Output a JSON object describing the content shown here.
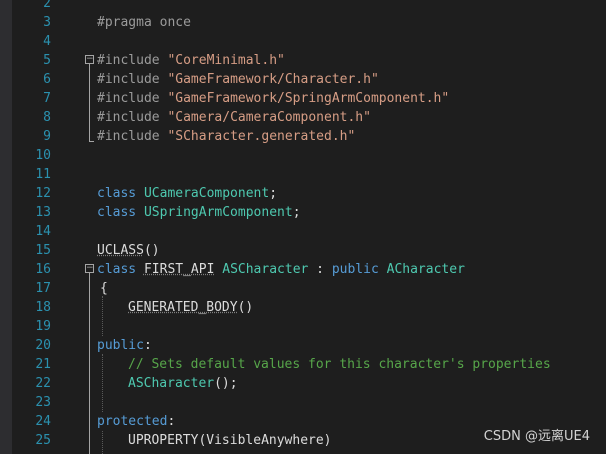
{
  "editor": {
    "lines": [
      {
        "n": "2",
        "text": ""
      },
      {
        "n": "3",
        "text": "#pragma once"
      },
      {
        "n": "4",
        "text": ""
      },
      {
        "n": "5",
        "text": "#include \"CoreMinimal.h\""
      },
      {
        "n": "6",
        "text": "#include \"GameFramework/Character.h\""
      },
      {
        "n": "7",
        "text": "#include \"GameFramework/SpringArmComponent.h\""
      },
      {
        "n": "8",
        "text": "#include \"Camera/CameraComponent.h\""
      },
      {
        "n": "9",
        "text": "#include \"SCharacter.generated.h\""
      },
      {
        "n": "10",
        "text": ""
      },
      {
        "n": "11",
        "text": ""
      },
      {
        "n": "12",
        "text": "class UCameraComponent;"
      },
      {
        "n": "13",
        "text": "class USpringArmComponent;"
      },
      {
        "n": "14",
        "text": ""
      },
      {
        "n": "15",
        "text": "UCLASS()"
      },
      {
        "n": "16",
        "text": "class FIRST_API ASCharacter : public ACharacter"
      },
      {
        "n": "17",
        "text": "{"
      },
      {
        "n": "18",
        "text": "GENERATED_BODY()"
      },
      {
        "n": "19",
        "text": ""
      },
      {
        "n": "20",
        "text": "public:"
      },
      {
        "n": "21",
        "text": "// Sets default values for this character's properties"
      },
      {
        "n": "22",
        "text": "ASCharacter();"
      },
      {
        "n": "23",
        "text": ""
      },
      {
        "n": "24",
        "text": "protected:"
      },
      {
        "n": "25",
        "text": "UPROPERTY(VisibleAnywhere)"
      }
    ],
    "tokens": {
      "pragma": "#pragma once",
      "include": "#include ",
      "inc1": "\"CoreMinimal.h\"",
      "inc2": "\"GameFramework/Character.h\"",
      "inc3": "\"GameFramework/SpringArmComponent.h\"",
      "inc4": "\"Camera/CameraComponent.h\"",
      "inc5": "\"SCharacter.generated.h\"",
      "class_kw": "class ",
      "ucamera": "UCameraComponent",
      "uspring": "USpringArmComponent",
      "semicolon": ";",
      "uclass": "UCLASS",
      "parens": "()",
      "first_api": "FIRST_API",
      "ascharacter": "ASCharacter",
      "colon": " : ",
      "public_kw": "public ",
      "acharacter": "ACharacter",
      "brace_open": "{",
      "generated_body": "GENERATED_BODY",
      "public_label": "public",
      "colon_only": ":",
      "comment": "// Sets default values for this character's properties",
      "ctor_call": "();",
      "protected_label": "protected",
      "uproperty": "UPROPERTY",
      "uproperty_args": "(VisibleAnywhere)"
    },
    "colors": {
      "background": "#1e1e1e",
      "line_number": "#2b91af",
      "keyword": "#569cd6",
      "type": "#4ec9b0",
      "string": "#d69d85",
      "comment": "#57a64a",
      "preprocessor": "#9b9b9b",
      "macro": "#bd63c5"
    }
  },
  "watermark": "CSDN @远离UE4"
}
